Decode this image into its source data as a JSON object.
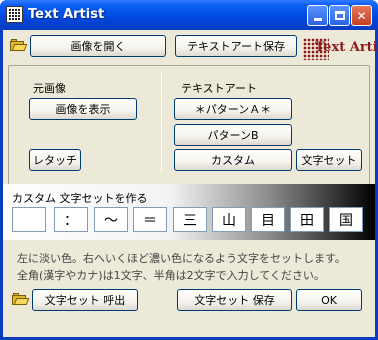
{
  "window": {
    "title": "Text Artist"
  },
  "toolbar": {
    "open_image_label": "画像を開く",
    "save_text_art_label": "テキストアート保存",
    "logo_text": "Text Artist"
  },
  "original": {
    "heading": "元画像",
    "show_image_label": "画像を表示",
    "retouch_label": "レタッチ"
  },
  "textart": {
    "heading": "テキストアート",
    "pattern_a_label": "＊パターンＡ＊",
    "pattern_b_label": "パターンB",
    "custom_label": "カスタム",
    "charset_label": "文字セット"
  },
  "custom_charset": {
    "heading": "カスタム  文字セットを作る",
    "chars": [
      "",
      "：",
      "～",
      "＝",
      "三",
      "山",
      "目",
      "田",
      "国"
    ]
  },
  "instructions": {
    "line1": "左に淡い色。右へいくほど濃い色になるよう文字をセットします。",
    "line2": "全角(漢字やカナ)は1文字、半角は2文字で入力してください。"
  },
  "footer": {
    "load_charset_label": "文字セット 呼出",
    "save_charset_label": "文字セット 保存",
    "ok_label": "OK"
  },
  "colors": {
    "titlebar": "#0a5ef5",
    "client_bg": "#ece9d8",
    "logo": "#8b1a1a"
  }
}
